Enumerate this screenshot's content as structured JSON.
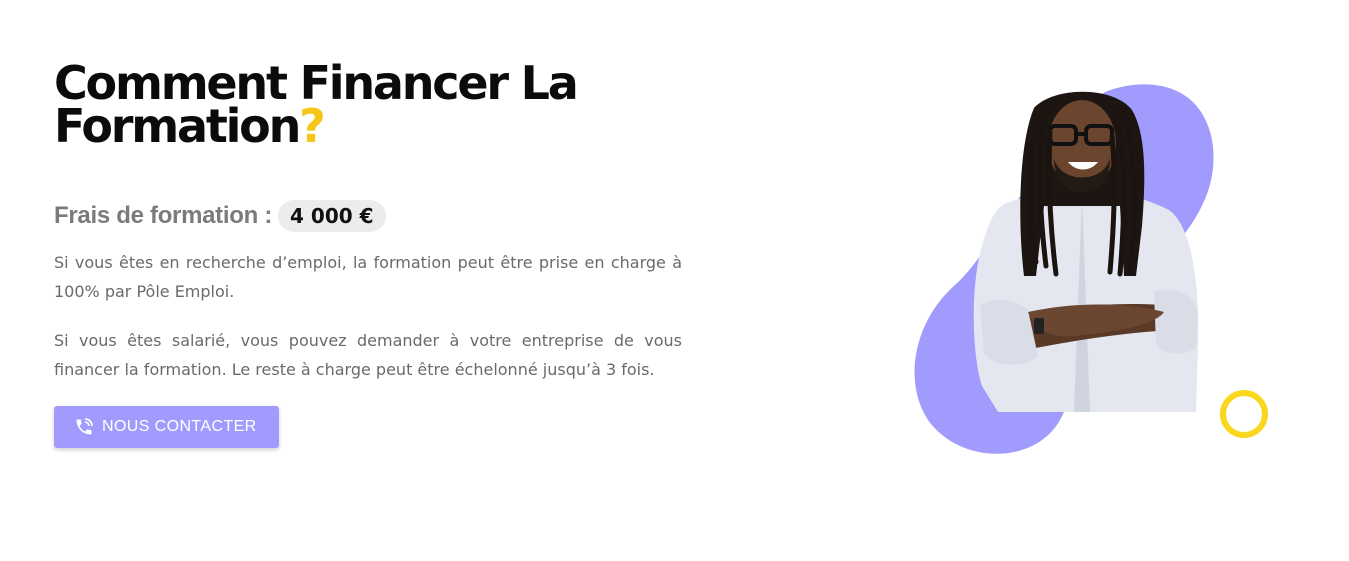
{
  "section": {
    "title_line1": "Comment Financer La",
    "title_line2": "Formation",
    "title_mark": "?",
    "price_label": "Frais de formation :",
    "price_value": "4 000 €",
    "paragraph1": "Si vous êtes en recherche d’emploi, la formation peut être prise en charge à 100% par Pôle Emploi.",
    "paragraph2": "Si vous êtes salarié, vous pouvez demander à votre entreprise de vous financer la formation. Le reste à charge peut être échelonné jusqu’à 3 fois.",
    "cta_label": "NOUS CONTACTER",
    "cta_icon": "phone-in-talk-icon"
  },
  "colors": {
    "accent_purple": "#a29bfe",
    "accent_yellow": "#f5c518",
    "ring_yellow": "#f9d71c",
    "title_text": "#0b0b0b",
    "body_text": "#6a6a6a",
    "badge_bg": "#ececec"
  }
}
